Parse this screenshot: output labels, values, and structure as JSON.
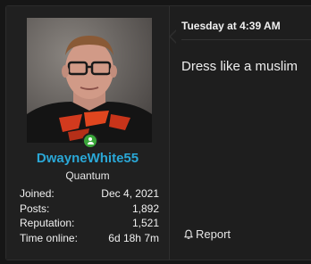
{
  "user": {
    "username": "DwayneWhite55",
    "title": "Quantum",
    "status_icon": "user-online-icon",
    "stats": [
      {
        "label": "Joined:",
        "value": "Dec 4, 2021"
      },
      {
        "label": "Posts:",
        "value": "1,892"
      },
      {
        "label": "Reputation:",
        "value": "1,521"
      },
      {
        "label": "Time online:",
        "value": "6d 18h 7m"
      }
    ]
  },
  "post": {
    "date": "Tuesday at 4:39 AM",
    "message": "Dress like a muslim",
    "report_label": "Report",
    "report_icon": "bell-icon"
  },
  "colors": {
    "background": "#161616",
    "username": "#2aa7d6",
    "online": "#3aa63a"
  }
}
